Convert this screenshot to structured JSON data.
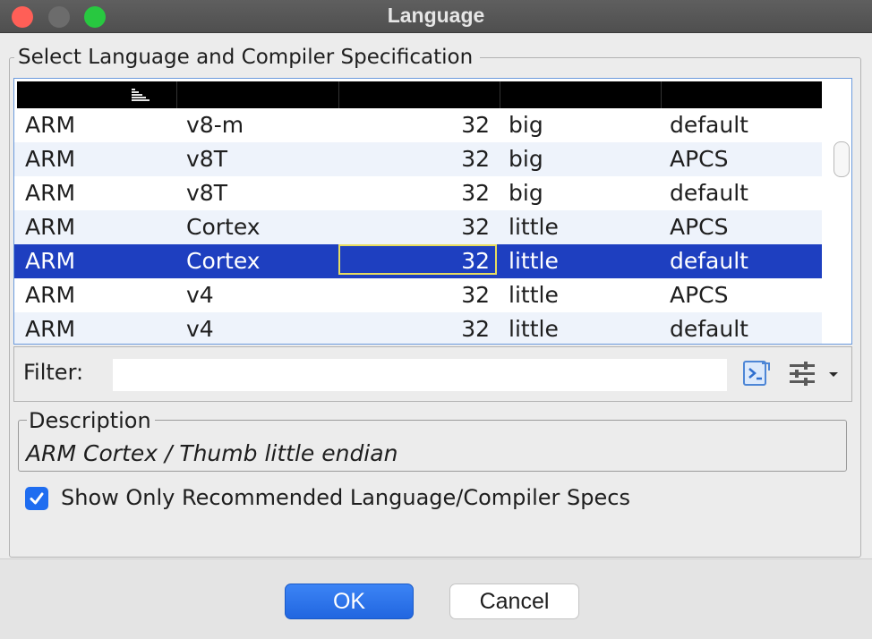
{
  "window": {
    "title": "Language"
  },
  "group": {
    "title": "Select Language and Compiler Specification"
  },
  "table": {
    "columns": [
      "",
      "",
      "",
      "",
      ""
    ],
    "rows": [
      [
        "ARM",
        "v8-m",
        "32",
        "big",
        "default"
      ],
      [
        "ARM",
        "v8T",
        "32",
        "big",
        "APCS"
      ],
      [
        "ARM",
        "v8T",
        "32",
        "big",
        "default"
      ],
      [
        "ARM",
        "Cortex",
        "32",
        "little",
        "APCS"
      ],
      [
        "ARM",
        "Cortex",
        "32",
        "little",
        "default"
      ],
      [
        "ARM",
        "v4",
        "32",
        "little",
        "APCS"
      ],
      [
        "ARM",
        "v4",
        "32",
        "little",
        "default"
      ]
    ],
    "selected_row_index": 4,
    "sort_icon": "sort-ascending-icon"
  },
  "filter": {
    "label": "Filter:",
    "value": "",
    "placeholder": ""
  },
  "description": {
    "title": "Description",
    "text": "ARM Cortex / Thumb little endian"
  },
  "checkbox": {
    "label": "Show Only Recommended Language/Compiler Specs",
    "checked": true
  },
  "buttons": {
    "ok": "OK",
    "cancel": "Cancel"
  },
  "colors": {
    "selection": "#1e3fc0",
    "accent": "#2f7af0",
    "focus_cell_border": "#e7dc60",
    "close": "#ff5f57",
    "maximize": "#28c840"
  }
}
